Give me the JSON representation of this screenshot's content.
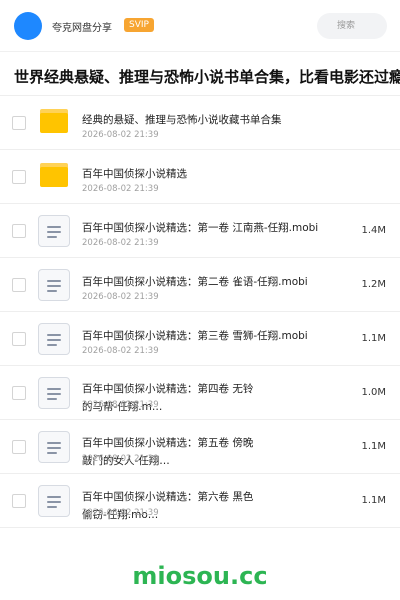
{
  "header": {
    "user_name": "夸克网盘分享",
    "badge": "SVIP",
    "search_placeholder": "搜索"
  },
  "page_title": "世界经典悬疑、推理与恐怖小说书单合集，比看电影还过瘾",
  "files": [
    {
      "type": "folder",
      "name": "经典的悬疑、推理与恐怖小说收藏书单合集",
      "date": "2026-08-02 21:39",
      "size": ""
    },
    {
      "type": "folder",
      "name": "百年中国侦探小说精选",
      "date": "2026-08-02 21:39",
      "size": ""
    },
    {
      "type": "file",
      "name": "百年中国侦探小说精选：第一卷 江南燕-任翔.mobi",
      "date": "2026-08-02 21:39",
      "size": "1.4M"
    },
    {
      "type": "file",
      "name": "百年中国侦探小说精选：第二卷 雀语-任翔.mobi",
      "date": "2026-08-02 21:39",
      "size": "1.2M"
    },
    {
      "type": "file",
      "name": "百年中国侦探小说精选：第三卷 雪狮-任翔.mobi",
      "date": "2026-08-02 21:39",
      "size": "1.1M"
    },
    {
      "type": "file",
      "name": "百年中国侦探小说精选：第四卷 无铃的马帮-任翔.m…",
      "date": "2026-08-02 21:39",
      "size": "1.0M"
    },
    {
      "type": "file",
      "name": "百年中国侦探小说精选：第五卷 傍晚敲门的女人-任翔…",
      "date": "2026-08-02 21:39",
      "size": "1.1M"
    },
    {
      "type": "file",
      "name": "百年中国侦探小说精选：第六卷 黑色偷窃-任翔.mo…",
      "date": "2026-08-02 21:39",
      "size": "1.1M"
    }
  ],
  "watermark": "miosou.cc",
  "colors": {
    "accent": "#1e88ff",
    "svip": "#f7a531",
    "folder": "#ffc400",
    "watermark": "#2db553"
  }
}
